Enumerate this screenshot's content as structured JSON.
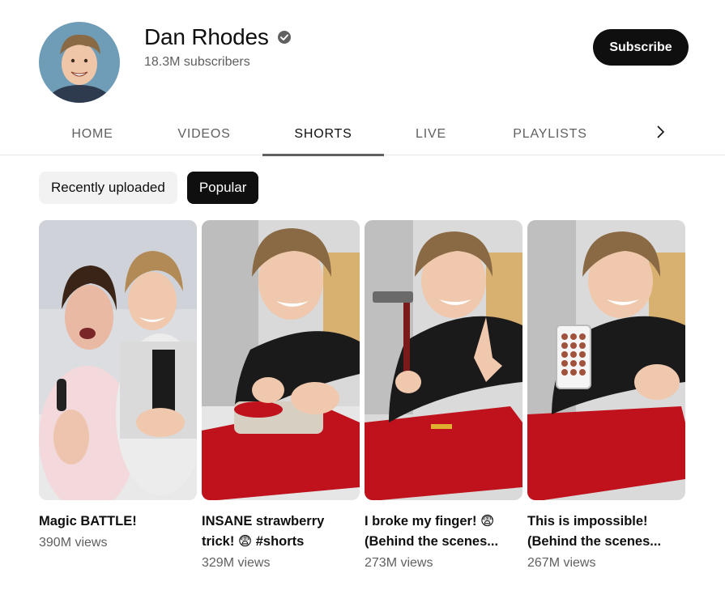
{
  "channel": {
    "name": "Dan Rhodes",
    "subscribers": "18.3M subscribers",
    "verified_icon": "verified-check-icon",
    "subscribe_label": "Subscribe"
  },
  "tabs": [
    {
      "label": "HOME",
      "active": false
    },
    {
      "label": "VIDEOS",
      "active": false
    },
    {
      "label": "SHORTS",
      "active": true
    },
    {
      "label": "LIVE",
      "active": false
    },
    {
      "label": "PLAYLISTS",
      "active": false
    }
  ],
  "tabs_more_icon": "chevron-right-icon",
  "filters": [
    {
      "label": "Recently uploaded",
      "active": false
    },
    {
      "label": "Popular",
      "active": true
    }
  ],
  "shorts": [
    {
      "title": "Magic BATTLE!",
      "views": "390M views"
    },
    {
      "title": "INSANE strawberry trick! 😨 #shorts",
      "views": "329M views"
    },
    {
      "title": "I broke my finger! 😨 (Behind the scenes...",
      "views": "273M views"
    },
    {
      "title": "This is impossible! (Behind the scenes...",
      "views": "267M views"
    }
  ],
  "colors": {
    "text_primary": "#0f0f0f",
    "text_secondary": "#606060",
    "chip_inactive": "#f2f2f2",
    "button_dark": "#0f0f0f",
    "felt_red": "#c0121c"
  }
}
